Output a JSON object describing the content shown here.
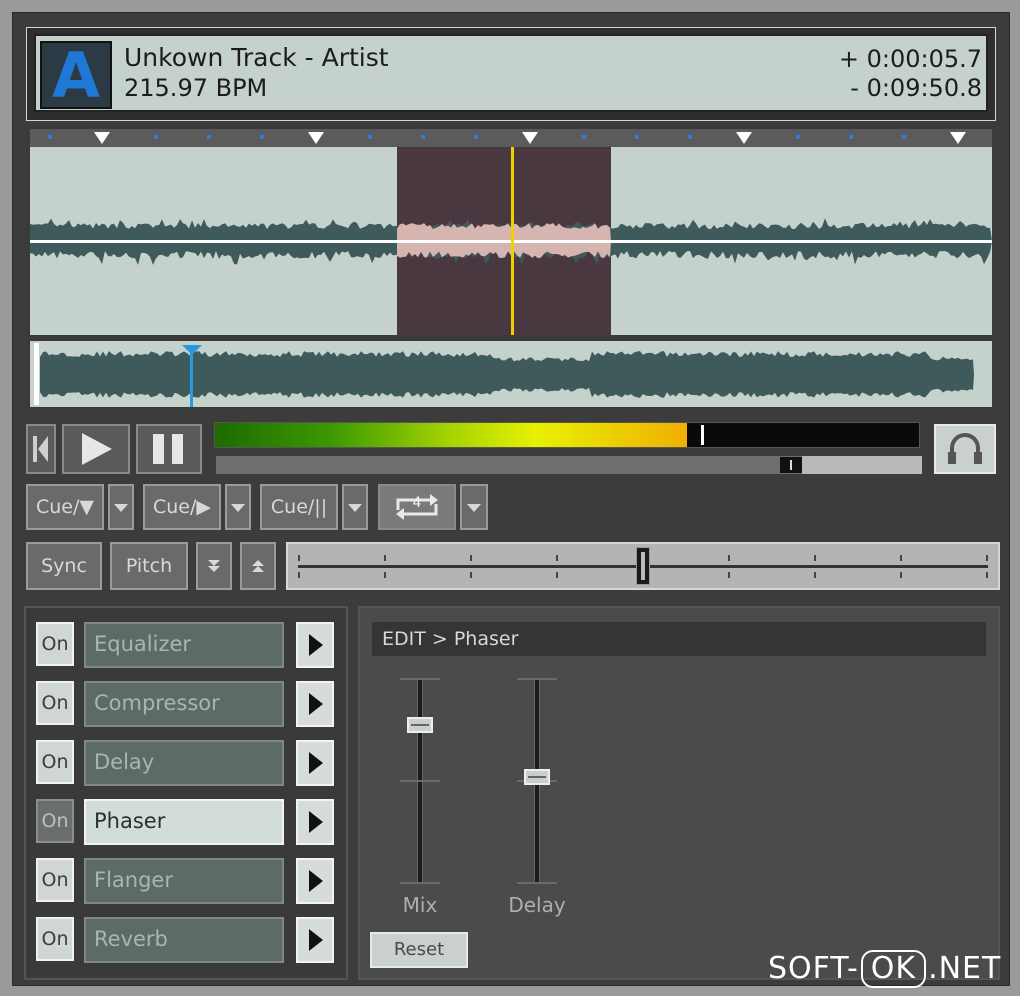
{
  "header": {
    "deck": "A",
    "track_title": "Unkown Track - Artist",
    "bpm": "215.97 BPM",
    "elapsed": "+ 0:00:05.7",
    "remaining": "- 0:09:50.8"
  },
  "transport": {
    "level_fill": 0.67,
    "position_fill": 0.83
  },
  "cue_buttons": [
    {
      "label": "Cue/▼"
    },
    {
      "label": "Cue/▶"
    },
    {
      "label": "Cue/||"
    }
  ],
  "loop": {
    "count": "4"
  },
  "tempo": {
    "sync_label": "Sync",
    "pitch_label": "Pitch",
    "pitch_value": 0.5
  },
  "effects": {
    "on_label": "On",
    "items": [
      {
        "name": "Equalizer",
        "selected": false
      },
      {
        "name": "Compressor",
        "selected": false
      },
      {
        "name": "Delay",
        "selected": false
      },
      {
        "name": "Phaser",
        "selected": true
      },
      {
        "name": "Flanger",
        "selected": false
      },
      {
        "name": "Reverb",
        "selected": false
      }
    ]
  },
  "edit": {
    "title": "EDIT > Phaser",
    "sliders": [
      {
        "label": "Mix",
        "value": 0.87
      },
      {
        "label": "Delay",
        "value": 0.6
      }
    ],
    "reset_label": "Reset"
  },
  "watermark": {
    "left": "SOFT-",
    "box": "OK",
    "right": ".NET"
  },
  "colors": {
    "accent_blue": "#1f78d6",
    "wave": "#3f5a5a",
    "wave_bg": "#c5d2cc",
    "highlight": "#4a3840",
    "playhead": "#f0d000"
  }
}
